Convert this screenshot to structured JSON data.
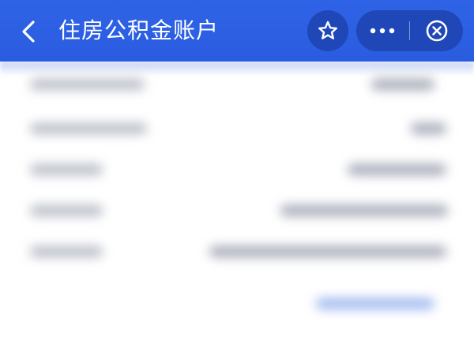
{
  "header": {
    "title": "住房公积金账户",
    "back_icon": "chevron-left-icon",
    "favorite_icon": "star-outline-icon",
    "more_icon": "more-horizontal-icon",
    "close_icon": "close-circle-icon"
  },
  "colors": {
    "header_background": "#2f63e6",
    "capsule_background": "#1f47b8",
    "header_text": "#ffffff",
    "blurred_text": "#b9bdc8",
    "blurred_link": "#9fb8ef"
  }
}
